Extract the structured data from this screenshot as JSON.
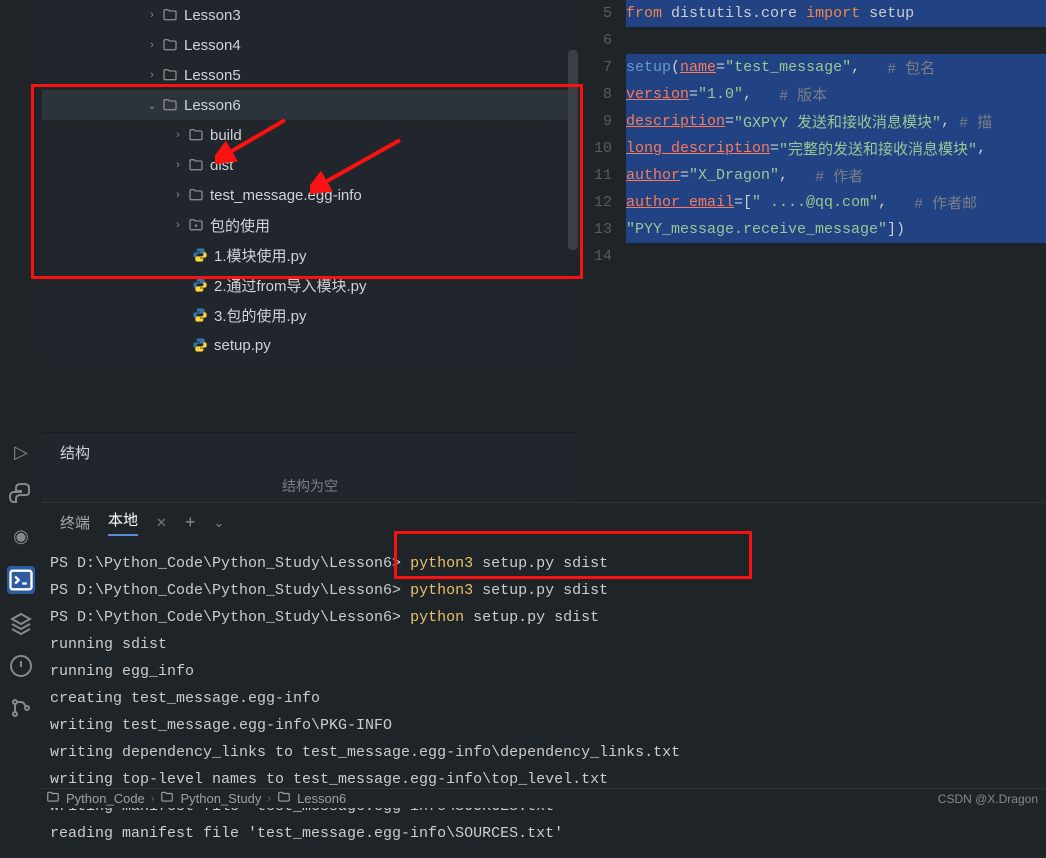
{
  "tree": {
    "lesson3": "Lesson3",
    "lesson4": "Lesson4",
    "lesson5": "Lesson5",
    "lesson6": "Lesson6",
    "build": "build",
    "dist": "dist",
    "egginfo": "test_message.egg-info",
    "pkguse": "包的使用",
    "f1": "1.模块使用.py",
    "f2": "2.通过from导入模块.py",
    "f3": "3.包的使用.py",
    "f4": "setup.py"
  },
  "structure": {
    "title": "结构",
    "empty": "结构为空"
  },
  "terminal_tabs": {
    "tab1": "终端",
    "tab2": "本地"
  },
  "terminal": {
    "l1_prompt": "PS D:\\Python_Code\\Python_Study\\Lesson6> ",
    "l1_cmd": " python3",
    "l1_args": " setup.py sdist",
    "l2_prompt": "PS D:\\Python_Code\\Python_Study\\Lesson6> ",
    "l2_cmd": "python3",
    "l2_args": " setup.py sdist",
    "l3_prompt": "PS D:\\Python_Code\\Python_Study\\Lesson6> ",
    "l3_cmd": "python",
    "l3_args": " setup.py sdist",
    "l4": "running sdist",
    "l5": "running egg_info",
    "l6": "creating test_message.egg-info",
    "l7": "writing test_message.egg-info\\PKG-INFO",
    "l8": "writing dependency_links to test_message.egg-info\\dependency_links.txt",
    "l9": "writing top-level names to test_message.egg-info\\top_level.txt",
    "l10": "writing manifest file 'test_message.egg-info\\SOURCES.txt'",
    "l11": "reading manifest file 'test_message.egg-info\\SOURCES.txt'"
  },
  "breadcrumb": {
    "b1": "Python_Code",
    "b2": "Python_Study",
    "b3": "Lesson6"
  },
  "watermark": "CSDN @X.Dragon",
  "code": {
    "l5": {
      "from": "from",
      "mod": "distutils.core",
      "imp": "import",
      "name": "setup"
    },
    "l7": {
      "fn": "setup",
      "open": "(",
      "prm": "name",
      "eq": "=",
      "val": "\"test_message\"",
      "comma": ",",
      "cmt": "# 包名"
    },
    "l8": {
      "prm": "version",
      "eq": "=",
      "val": "\"1.0\"",
      "comma": ",",
      "cmt": "# 版本"
    },
    "l9": {
      "prm": "description",
      "eq": "=",
      "val": "\"GXPYY 发送和接收消息模块\"",
      "comma": ",",
      "cmt": "# 描"
    },
    "l10": {
      "prm": "long_description",
      "eq": "=",
      "val": "\"完整的发送和接收消息模块\"",
      "comma": ","
    },
    "l11": {
      "prm": "author",
      "eq": "=",
      "val": "\"X_Dragon\"",
      "comma": ",",
      "cmt": "# 作者"
    },
    "l12": {
      "prm": "author_email",
      "eq": "=[",
      "val": "\" ....@qq.com\"",
      "comma": ",",
      "cmt": "# 作者邮"
    },
    "l13": {
      "val": "\"PYY_message.receive_message\"",
      "close": "])"
    }
  }
}
